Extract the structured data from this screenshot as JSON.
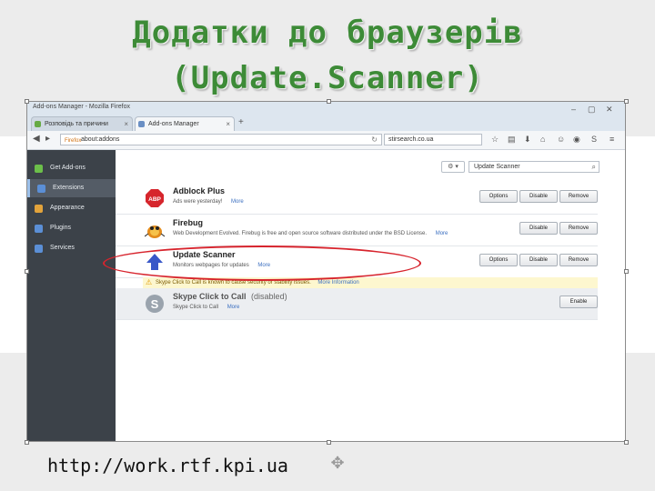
{
  "slide": {
    "title_line1": "Додатки до браузерів",
    "title_line2": "(Update.Scanner)",
    "footer_url": "http://work.rtf.kpi.ua"
  },
  "browser": {
    "window_title": "Add-ons Manager - Mozilla Firefox",
    "tabs": [
      {
        "label": "Розповідь та причини редагув...",
        "active": false
      },
      {
        "label": "Add-ons Manager",
        "active": true
      }
    ],
    "url_tag": "Firefox",
    "url": "about:addons",
    "search_value": "stirsearch.co.ua"
  },
  "addons_manager": {
    "sidebar": [
      {
        "label": "Get Add-ons",
        "icon": "get-addons-icon",
        "color": "#6cbf4a",
        "active": false
      },
      {
        "label": "Extensions",
        "icon": "puzzle-icon",
        "color": "#5b8fd6",
        "active": true
      },
      {
        "label": "Appearance",
        "icon": "appearance-icon",
        "color": "#e2a33b",
        "active": false
      },
      {
        "label": "Plugins",
        "icon": "plugin-icon",
        "color": "#5b8fd6",
        "active": false
      },
      {
        "label": "Services",
        "icon": "services-icon",
        "color": "#5b8fd6",
        "active": false
      }
    ],
    "tools_label": "⚙ ▾",
    "search_value": "Update Scanner",
    "addons": [
      {
        "name": "Adblock Plus",
        "description": "Ads were yesterday!",
        "more": "More",
        "buttons": [
          "Options",
          "Disable",
          "Remove"
        ],
        "disabled": false
      },
      {
        "name": "Firebug",
        "description": "Web Development Evolved. Firebug is free and open source software distributed under the BSD License.",
        "more": "More",
        "buttons": [
          "Disable",
          "Remove"
        ],
        "disabled": false
      },
      {
        "name": "Update Scanner",
        "description": "Monitors webpages for updates",
        "more": "More",
        "buttons": [
          "Options",
          "Disable",
          "Remove"
        ],
        "disabled": false
      },
      {
        "name": "Skype Click to Call",
        "disabled_label": "(disabled)",
        "description": "Skype Click to Call",
        "more": "More",
        "buttons": [
          "Enable"
        ],
        "disabled": true
      }
    ],
    "warning": {
      "text": "Skype Click to Call is known to cause security or stability issues.",
      "link": "More Information"
    }
  },
  "colors": {
    "title_green": "#3d8b37",
    "highlight_red": "#d7242d",
    "sidebar_bg": "#3c4249"
  }
}
